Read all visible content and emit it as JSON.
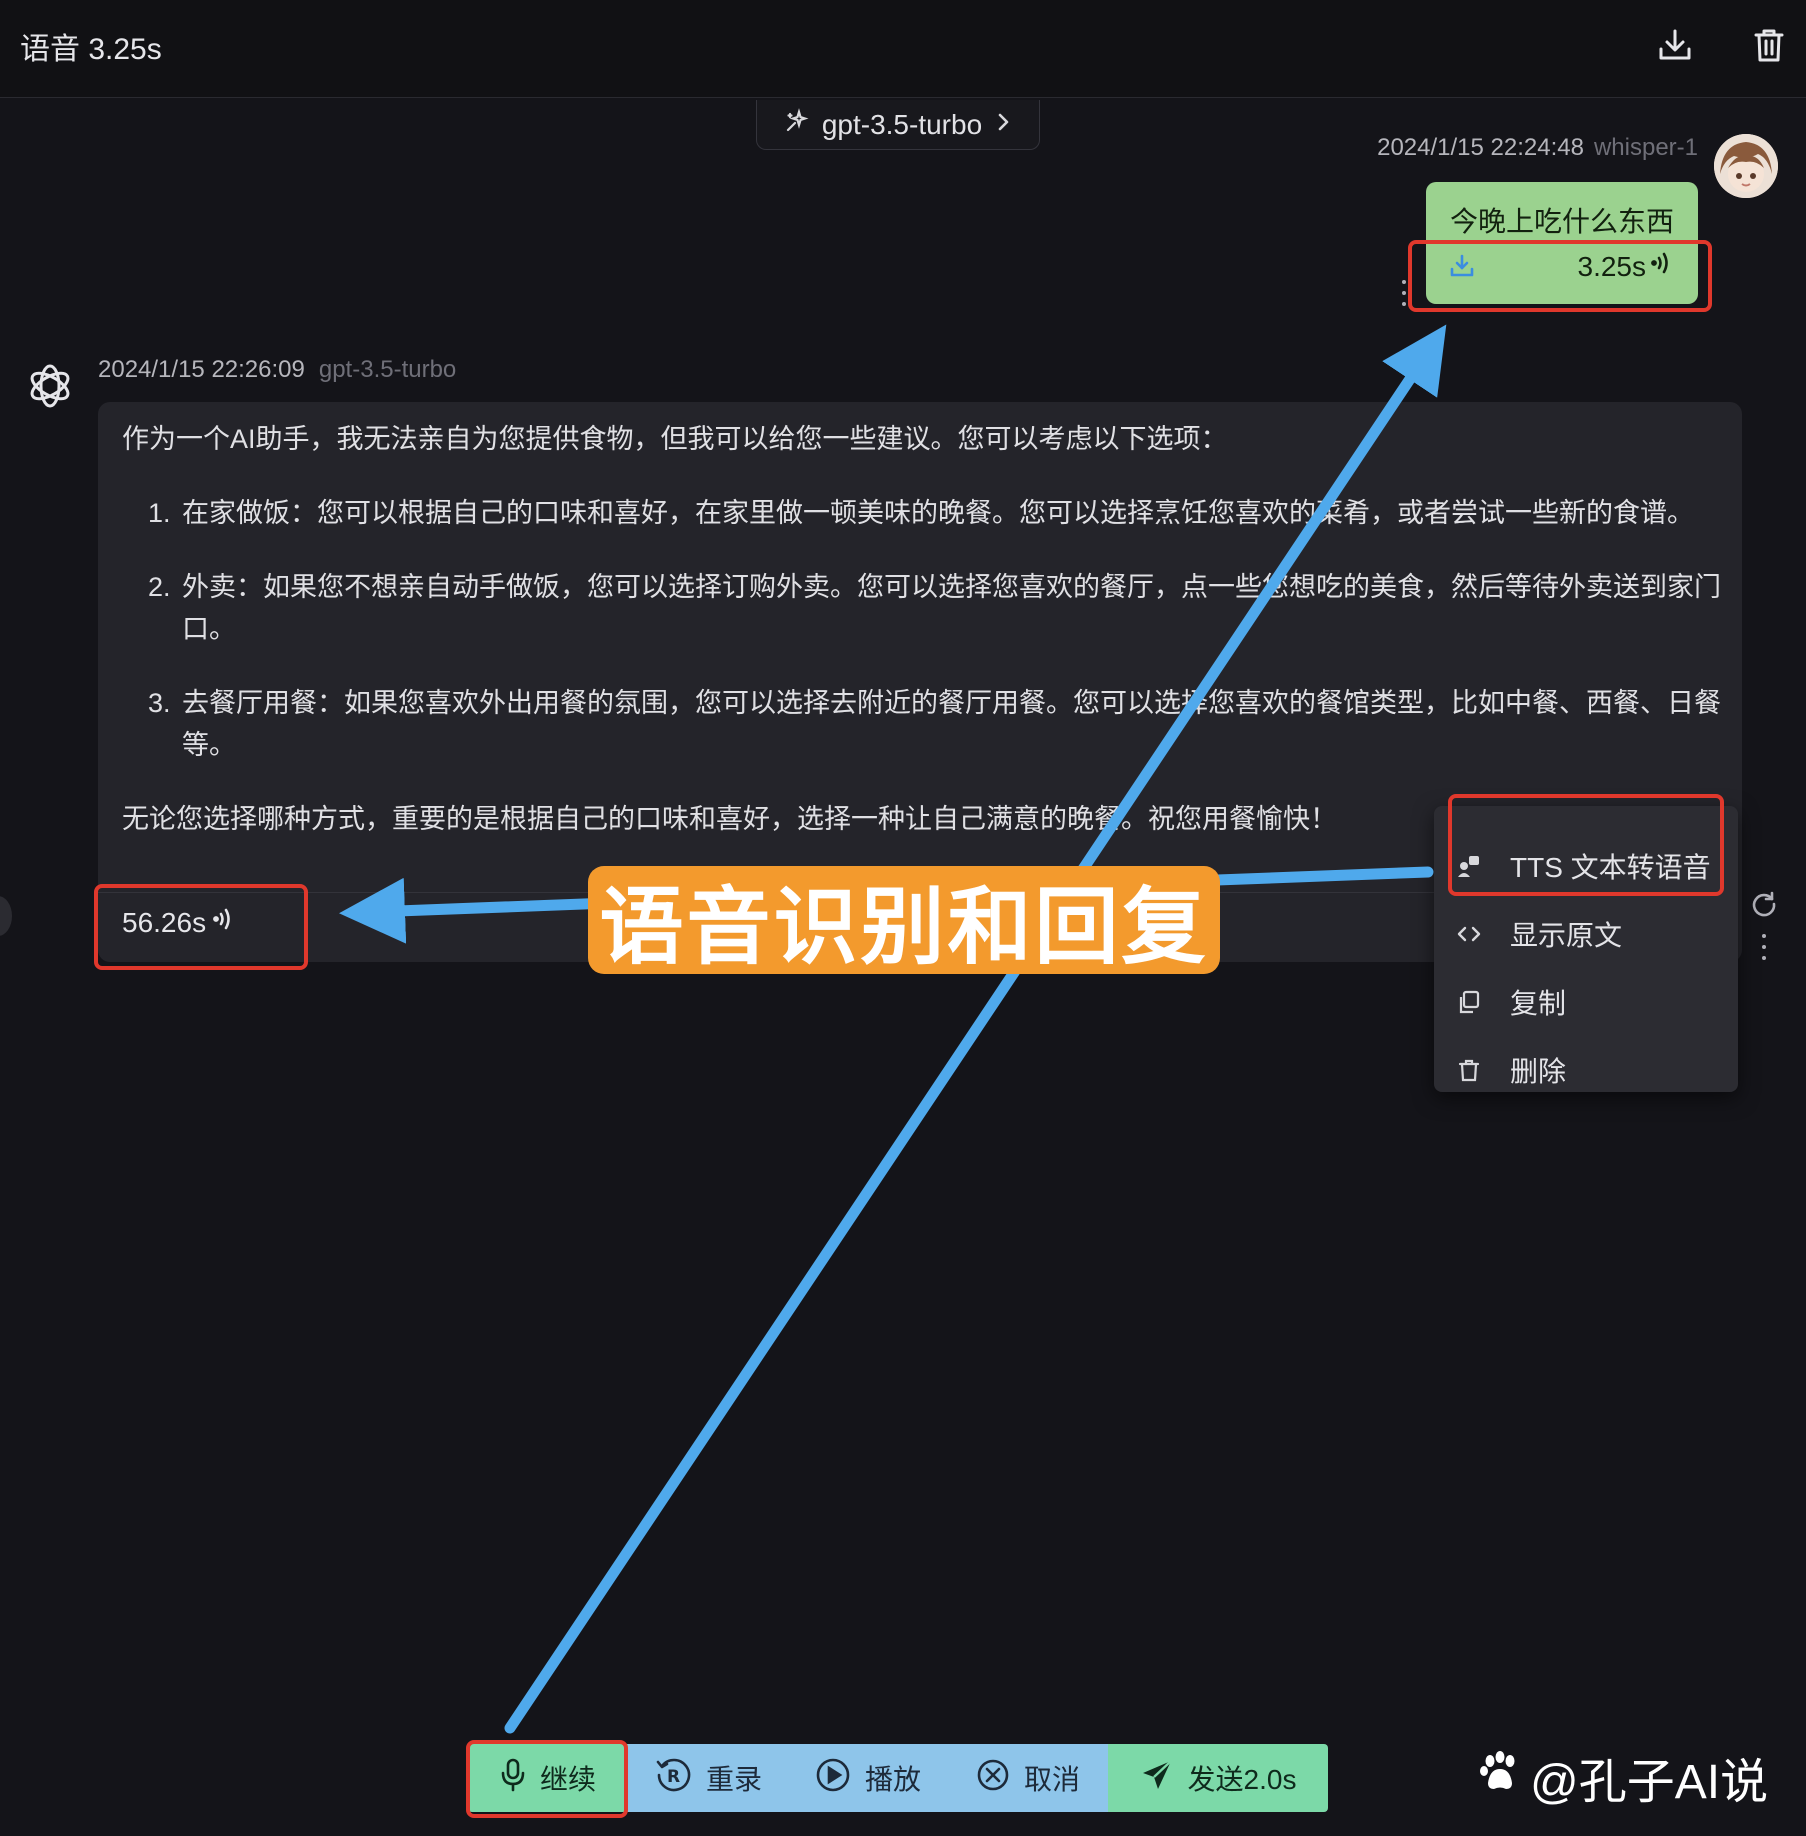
{
  "header": {
    "title": "语音 3.25s",
    "download_icon": "download-icon",
    "trash_icon": "trash-icon"
  },
  "model_selector": {
    "label": "gpt-3.5-turbo",
    "icon": "sparkle-icon",
    "chevron": "›"
  },
  "user_message": {
    "timestamp": "2024/1/15 22:24:48",
    "model": "whisper-1",
    "text": "今晚上吃什么东西",
    "audio_duration": "3.25s",
    "audio_icon": "sound-wave-icon"
  },
  "bot_message": {
    "timestamp": "2024/1/15 22:26:09",
    "model": "gpt-3.5-turbo",
    "intro": "作为一个AI助手，我无法亲自为您提供食物，但我可以给您一些建议。您可以考虑以下选项：",
    "items": [
      "在家做饭：您可以根据自己的口味和喜好，在家里做一顿美味的晚餐。您可以选择烹饪您喜欢的菜肴，或者尝试一些新的食谱。",
      "外卖：如果您不想亲自动手做饭，您可以选择订购外卖。您可以选择您喜欢的餐厅，点一些您想吃的美食，然后等待外卖送到家门口。",
      "去餐厅用餐：如果您喜欢外出用餐的氛围，您可以选择去附近的餐厅用餐。您可以选择您喜欢的餐馆类型，比如中餐、西餐、日餐等。"
    ],
    "outro": "无论您选择哪种方式，重要的是根据自己的口味和喜好，选择一种让自己满意的晚餐。祝您用餐愉快！",
    "audio_duration": "56.26s"
  },
  "context_menu": {
    "items": [
      {
        "label": "TTS 文本转语音",
        "icon": "tts-icon"
      },
      {
        "label": "显示原文",
        "icon": "code-icon"
      },
      {
        "label": "复制",
        "icon": "copy-icon"
      },
      {
        "label": "删除",
        "icon": "trash-icon"
      }
    ]
  },
  "overlay_label": "语音识别和回复",
  "toolbar": {
    "buttons": [
      {
        "label": "继续",
        "icon": "microphone-icon"
      },
      {
        "label": "重录",
        "icon": "rerecord-icon"
      },
      {
        "label": "播放",
        "icon": "play-icon"
      },
      {
        "label": "取消",
        "icon": "cancel-icon"
      },
      {
        "label": "发送2.0s",
        "icon": "send-icon"
      }
    ]
  },
  "watermark": "@孔子AI说",
  "colors": {
    "background": "#141419",
    "user_bubble": "#9bd28f",
    "highlight_red": "#e0382c",
    "arrow_blue": "#4fa9ec",
    "overlay_orange": "#f39a2d",
    "toolbar_green": "#7cd9a8",
    "toolbar_blue": "#8ec5ea"
  }
}
